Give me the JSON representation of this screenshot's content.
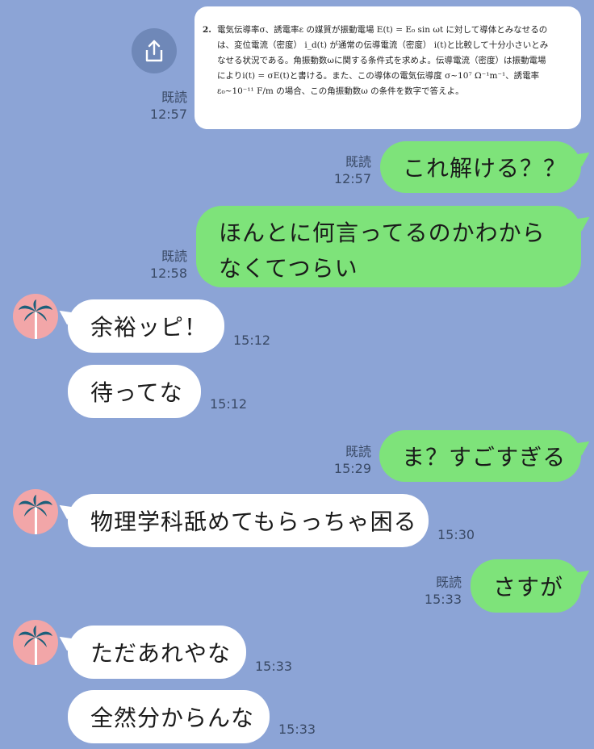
{
  "image_message": {
    "problem_number": "2.",
    "problem_text": "電気伝導率σ、誘電率ε の媒質が振動電場 E(t) = E₀ sin ωt に対して導体とみなせるの\nは、変位電流（密度） i_d(t) が通常の伝導電流（密度） i(t)と比較して十分小さいとみ\nなせる状況である。角振動数ωに関する条件式を求めよ。伝導電流（密度）は振動電場\nによりi(t) = σE(t)と書ける。また、この導体の電気伝導度 σ~10⁷ Ω⁻¹m⁻¹、誘電率\nε₀~10⁻¹¹ F/m の場合、この角振動数ω の条件を数字で答えよ。",
    "read": "既読",
    "time": "12:57"
  },
  "messages": [
    {
      "text": "これ解ける？？",
      "read": "既読",
      "time": "12:57"
    },
    {
      "text": "ほんとに何言ってるのかわからなくてつらい",
      "read": "既読",
      "time": "12:58"
    },
    {
      "text": "余裕ッピ！",
      "time": "15:12"
    },
    {
      "text": "待ってな",
      "time": "15:12"
    },
    {
      "text": "ま？すごすぎる",
      "read": "既読",
      "time": "15:29"
    },
    {
      "text": "物理学科舐めてもらっちゃ困る",
      "time": "15:30"
    },
    {
      "text": "さすが",
      "read": "既読",
      "time": "15:33"
    },
    {
      "text": "ただあれやな",
      "time": "15:33"
    },
    {
      "text": "全然分からんな",
      "time": "15:33"
    }
  ],
  "colors": {
    "background": "#8ca4d6",
    "my_bubble": "#7ee37a",
    "their_bubble": "#ffffff",
    "avatar_bg": "#f2a6a8",
    "palm_trunk": "#ffffff",
    "palm_leaves": "#1c5f7a"
  },
  "icons": {
    "share": "share-upload-icon",
    "avatar": "palm-tree-icon"
  }
}
